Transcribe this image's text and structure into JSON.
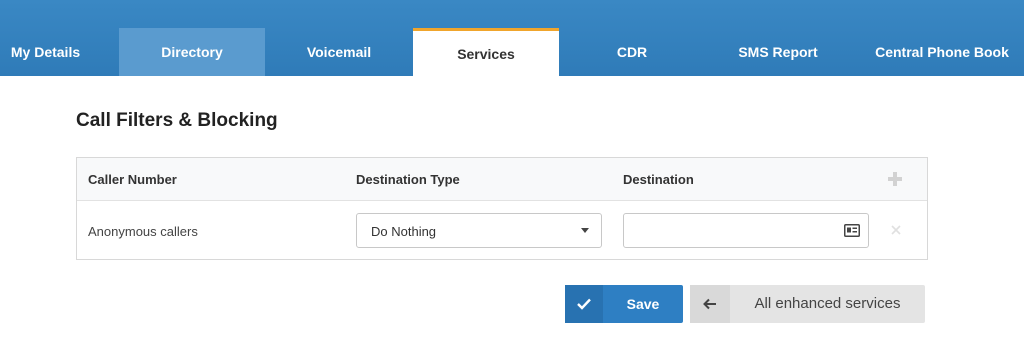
{
  "tabs": [
    {
      "label": "My Details",
      "state": "normal"
    },
    {
      "label": "Directory",
      "state": "hover"
    },
    {
      "label": "Voicemail",
      "state": "normal"
    },
    {
      "label": "Services",
      "state": "active"
    },
    {
      "label": "CDR",
      "state": "normal"
    },
    {
      "label": "SMS Report",
      "state": "normal"
    },
    {
      "label": "Central Phone Book",
      "state": "normal"
    }
  ],
  "section": {
    "title": "Call Filters & Blocking"
  },
  "table": {
    "headers": {
      "caller_number": "Caller Number",
      "destination_type": "Destination Type",
      "destination": "Destination"
    },
    "rows": [
      {
        "caller_number": "Anonymous callers",
        "destination_type": "Do Nothing",
        "destination": ""
      }
    ]
  },
  "actions": {
    "save_label": "Save",
    "back_label": "All enhanced services"
  },
  "icons": {
    "add": "plus-icon",
    "remove": "close-icon",
    "contact_card": "contact-card-icon",
    "save": "checkmark-icon",
    "back": "arrow-left-icon"
  },
  "colors": {
    "header_bar": "#3a88c4",
    "active_tab_accent": "#f0a52c",
    "primary_button": "#2e7fc3",
    "secondary_button": "#e4e4e4"
  }
}
